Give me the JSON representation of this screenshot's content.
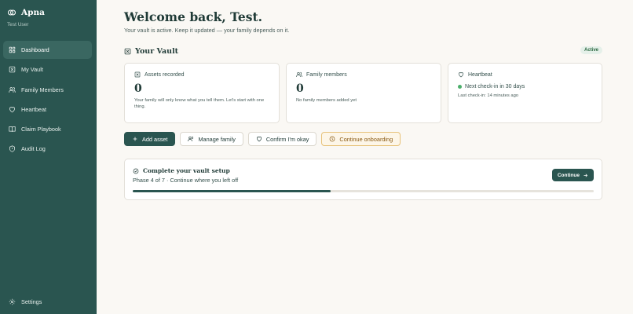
{
  "app": {
    "name": "Apna",
    "user": "Test User"
  },
  "sidebar": {
    "items": [
      {
        "label": "Dashboard",
        "icon": "grid-icon"
      },
      {
        "label": "My Vault",
        "icon": "vault-icon"
      },
      {
        "label": "Family Members",
        "icon": "users-icon"
      },
      {
        "label": "Heartbeat",
        "icon": "heart-icon"
      },
      {
        "label": "Claim Playbook",
        "icon": "book-icon"
      },
      {
        "label": "Audit Log",
        "icon": "shield-icon"
      }
    ],
    "settings_label": "Settings"
  },
  "header": {
    "title": "Welcome back, Test.",
    "subtitle": "Your vault is active. Keep it updated — your family depends on it."
  },
  "vault": {
    "title": "Your Vault",
    "status": "Active",
    "cards": {
      "assets": {
        "label": "Assets recorded",
        "value": "0",
        "desc": "Your family will only know what you tell them. Let's start with one thing."
      },
      "family": {
        "label": "Family members",
        "value": "0",
        "desc": "No family members added yet"
      },
      "heartbeat": {
        "label": "Heartbeat",
        "next": "Next check-in in 30 days",
        "last": "Last check-in: 14 minutes ago"
      }
    }
  },
  "actions": {
    "add_asset": "Add asset",
    "manage_family": "Manage family",
    "confirm_okay": "Confirm I'm okay",
    "continue_onboarding": "Continue onboarding"
  },
  "setup": {
    "title": "Complete your vault setup",
    "subtitle": "Phase 4 of 7 · Continue where you left off",
    "continue_label": "Continue",
    "progress": 0.43
  },
  "colors": {
    "sidebar": "#2a5550",
    "accent": "#2a5550",
    "active_badge": "#2d6a43",
    "warn": "#8a5a12"
  }
}
